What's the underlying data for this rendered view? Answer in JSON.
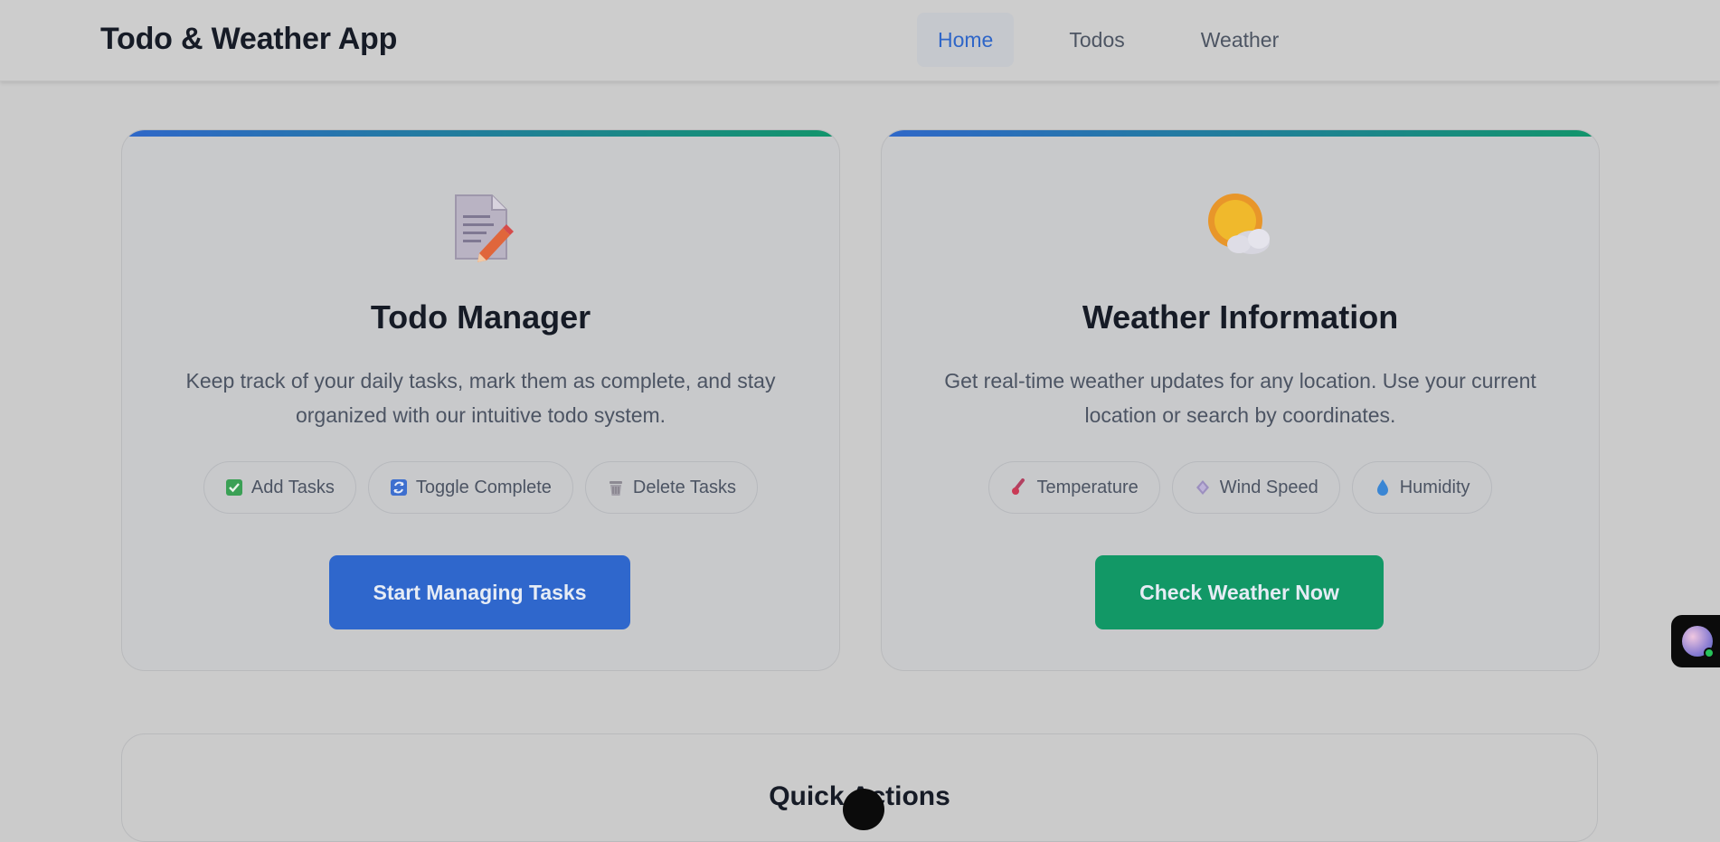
{
  "app": {
    "title": "Todo & Weather App"
  },
  "nav": {
    "items": [
      {
        "label": "Home",
        "active": true
      },
      {
        "label": "Todos",
        "active": false
      },
      {
        "label": "Weather",
        "active": false
      }
    ]
  },
  "cards": {
    "todo": {
      "icon": "memo-icon",
      "title": "Todo Manager",
      "description": "Keep track of your daily tasks, mark them as complete, and stay organized with our intuitive todo system.",
      "chips": [
        {
          "label": "Add Tasks",
          "icon": "check-box-icon"
        },
        {
          "label": "Toggle Complete",
          "icon": "refresh-icon"
        },
        {
          "label": "Delete Tasks",
          "icon": "wastebasket-icon"
        }
      ],
      "cta": "Start Managing Tasks"
    },
    "weather": {
      "icon": "sun-behind-cloud-icon",
      "title": "Weather Information",
      "description": "Get real-time weather updates for any location. Use your current location or search by coordinates.",
      "chips": [
        {
          "label": "Temperature",
          "icon": "thermometer-icon"
        },
        {
          "label": "Wind Speed",
          "icon": "wind-icon"
        },
        {
          "label": "Humidity",
          "icon": "droplet-icon"
        }
      ],
      "cta": "Check Weather Now"
    }
  },
  "quick_actions": {
    "title": "Quick Actions"
  },
  "colors": {
    "accent_blue": "#2f67cc",
    "accent_green": "#129866",
    "nav_active": "#2f66c8"
  }
}
